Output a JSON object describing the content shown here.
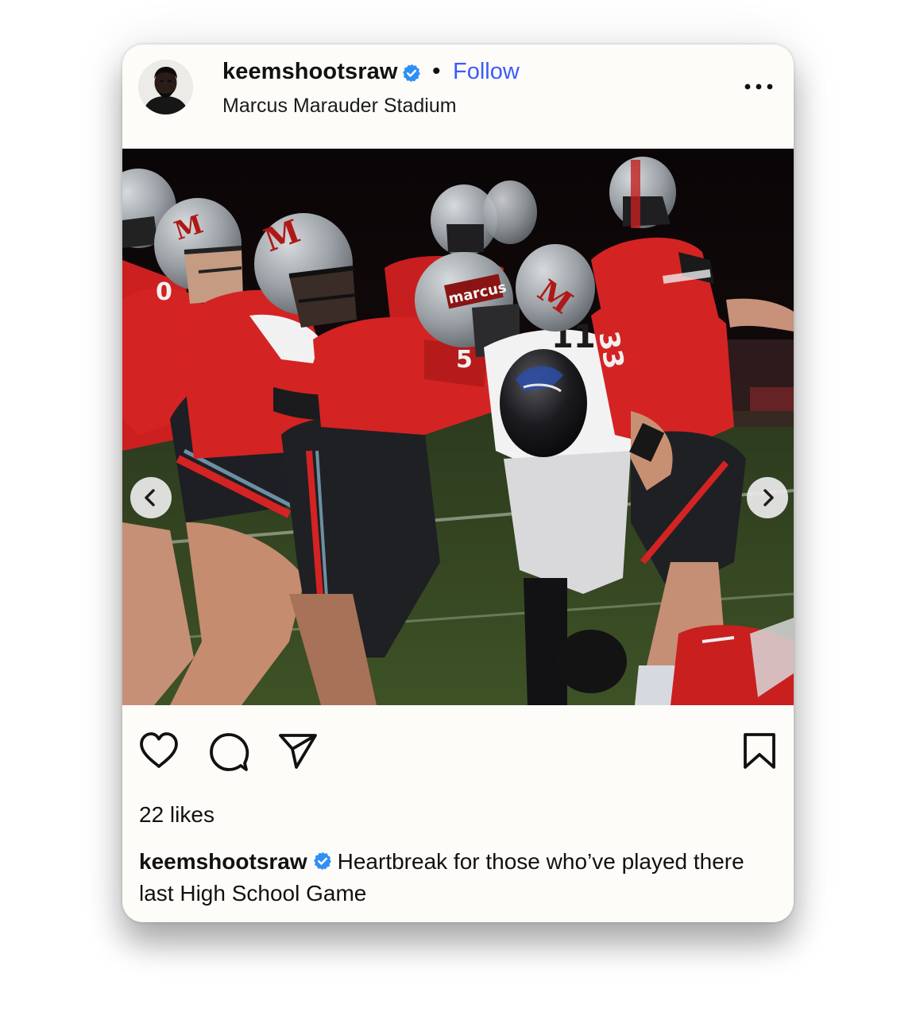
{
  "post": {
    "username": "keemshootsraw",
    "separator": "•",
    "follow_label": "Follow",
    "location": "Marcus Marauder Stadium",
    "likes": "22 likes",
    "caption_user": "keemshootsraw",
    "caption_text": "Heartbreak for those who’ve played there last High School Game"
  },
  "image": {
    "helmet_text": "marcus",
    "helmet_letter": "M",
    "jersey_numbers": [
      "0",
      "33"
    ]
  },
  "icons": {
    "verified": "verified-badge-icon",
    "more": "more-horizontal-icon",
    "prev": "chevron-left-icon",
    "next": "chevron-right-icon",
    "like": "heart-icon",
    "comment": "comment-icon",
    "share": "paper-plane-icon",
    "save": "bookmark-icon"
  },
  "colors": {
    "follow": "#3d5afe",
    "verified": "#2f8ff5",
    "jersey_red": "#d42323",
    "helmet_silver": "#9da3a8"
  }
}
